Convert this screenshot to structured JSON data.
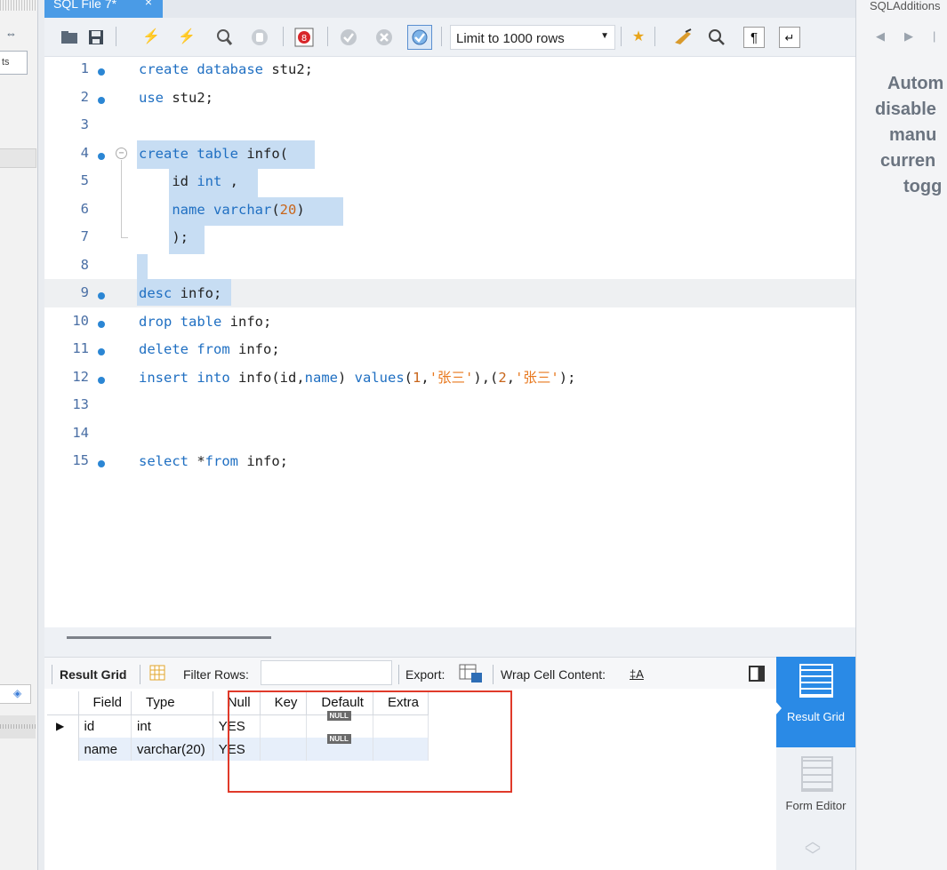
{
  "tab": {
    "title": "SQL File 7*",
    "close": "×"
  },
  "toolbar": {
    "limit_select": "Limit to 1000 rows",
    "icons": [
      "folder-open-icon",
      "save-icon",
      "execute-icon",
      "execute-current-icon",
      "explain-icon",
      "stop-icon",
      "toggle-error-icon",
      "commit-icon",
      "rollback-icon",
      "autocommit-icon",
      "bookmark-icon",
      "beautify-icon",
      "find-icon",
      "invisible-chars-icon",
      "wrap-lines-icon"
    ]
  },
  "editor": {
    "lines": [
      {
        "num": "1",
        "text": "create database stu2;"
      },
      {
        "num": "2",
        "text": "use stu2;"
      },
      {
        "num": "3",
        "text": ""
      },
      {
        "num": "4",
        "text": "create table info("
      },
      {
        "num": "5",
        "text": "    id int ,"
      },
      {
        "num": "6",
        "text": "    name varchar(20)"
      },
      {
        "num": "7",
        "text": "    );"
      },
      {
        "num": "8",
        "text": ""
      },
      {
        "num": "9",
        "text": "desc info;"
      },
      {
        "num": "10",
        "text": "drop table info;"
      },
      {
        "num": "11",
        "text": "delete from info;"
      },
      {
        "num": "12",
        "text": "insert into info(id,name) values(1,'张三'),(2,'张三');"
      },
      {
        "num": "13",
        "text": ""
      },
      {
        "num": "14",
        "text": ""
      },
      {
        "num": "15",
        "text": "select *from info;"
      }
    ],
    "fold_marker": "−"
  },
  "result_toolbar": {
    "result_grid": "Result Grid",
    "filter_rows": "Filter Rows:",
    "filter_value": "",
    "export": "Export:",
    "wrap_cell": "Wrap Cell Content:"
  },
  "result_grid": {
    "columns": [
      "Field",
      "Type",
      "Null",
      "Key",
      "Default",
      "Extra"
    ],
    "rows": [
      {
        "Field": "id",
        "Type": "int",
        "Null": "YES",
        "Key": "",
        "Default": "NULL",
        "Extra": ""
      },
      {
        "Field": "name",
        "Type": "varchar(20)",
        "Null": "YES",
        "Key": "",
        "Default": "NULL",
        "Extra": ""
      }
    ],
    "current_row_marker": "▶"
  },
  "side_results": {
    "result_grid_label": "Result Grid",
    "form_editor_label": "Form Editor"
  },
  "right_panel": {
    "title": "SQLAdditions",
    "message_lines": [
      "Autom",
      "disable",
      "manu",
      "curren",
      "togg"
    ]
  },
  "left_pane": {
    "field_text": "ts"
  }
}
